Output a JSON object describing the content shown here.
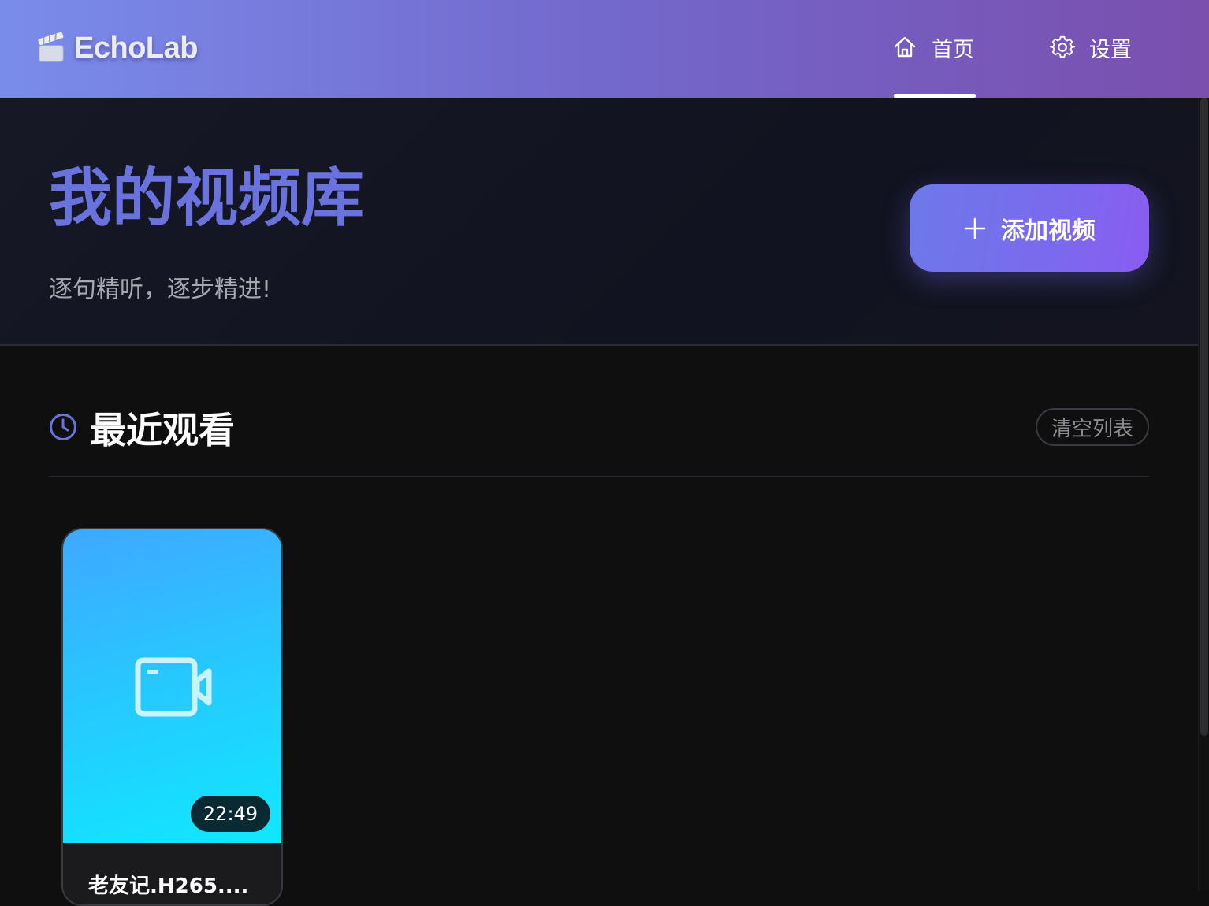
{
  "header": {
    "logo_text": "EchoLab",
    "nav": [
      {
        "label": "首页",
        "icon": "home-icon",
        "active": true
      },
      {
        "label": "设置",
        "icon": "gear-icon",
        "active": false
      }
    ]
  },
  "hero": {
    "title": "我的视频库",
    "subtitle": "逐句精听，逐步精进!",
    "add_button_label": "添加视频"
  },
  "recent": {
    "title": "最近观看",
    "clear_label": "清空列表",
    "videos": [
      {
        "title": "老友记.H265....",
        "duration": "22:49"
      }
    ]
  },
  "colors": {
    "accent": "#6a73dd",
    "header_gradient_start": "#7a8cea",
    "header_gradient_end": "#7a4fae",
    "thumb_gradient_start": "#40a8ff",
    "thumb_gradient_end": "#10e8ff"
  }
}
